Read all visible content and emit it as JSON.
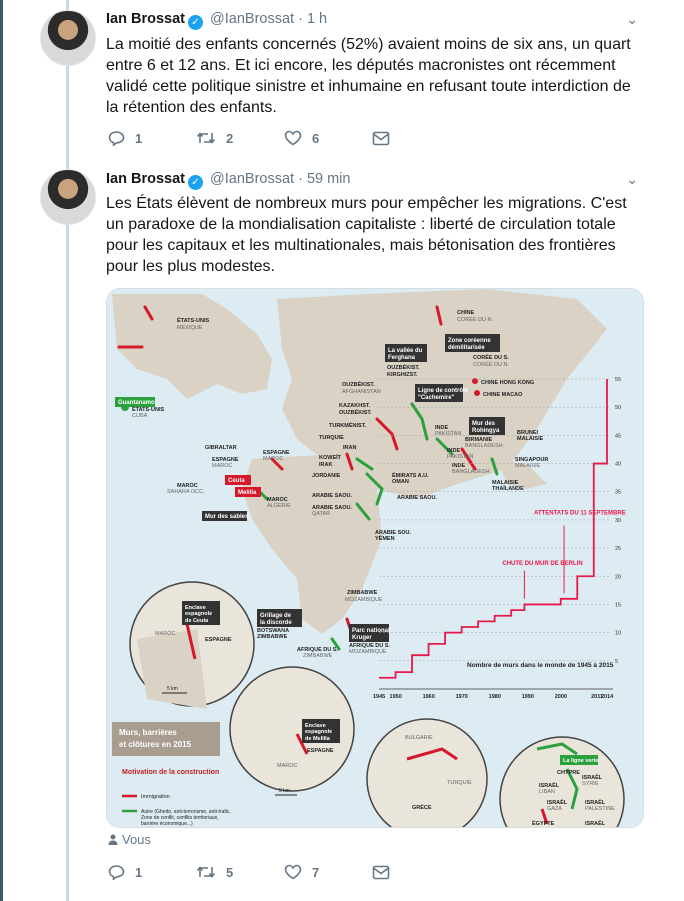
{
  "tweets": [
    {
      "name": "Ian Brossat",
      "handle": "@IanBrossat",
      "time": "· 1 h",
      "text": "La moitié des enfants concernés (52%) avaient moins de six ans, un quart entre 6 et 12 ans. Et ici encore, les députés macronistes ont récemment validé cette politique sinistre et inhumaine en refusant toute interdiction de la rétention des enfants.",
      "replies": "1",
      "retweets": "2",
      "likes": "6"
    },
    {
      "name": "Ian Brossat",
      "handle": "@IanBrossat",
      "time": "· 59 min",
      "text": "Les États élèvent de nombreux murs pour empêcher les migrations. C'est un paradoxe de la mondialisation capitaliste : liberté de circulation totale pour les capitaux et les multinationales, mais bétonisation des frontières pour les plus modestes.",
      "replies": "1",
      "retweets": "5",
      "likes": "7"
    }
  ],
  "media_reply_label": "Vous",
  "map": {
    "region_labels": [
      "ÉTATS-UNIS",
      "MEXIQUE",
      "CUBA",
      "CHINE",
      "CORÉE DU N.",
      "CORÉE DU S.",
      "OUZBÉKIST.",
      "KIRGHIZST.",
      "AFGHANISTAN",
      "KAZAKHST.",
      "TURKMÉNIST.",
      "INDE",
      "PAKISTAN",
      "BIRMANIE",
      "BANGLADESH",
      "IRAN",
      "IRAK",
      "KOWEÏT",
      "JORDANIE",
      "ARABIE SAOU.",
      "QATAR",
      "ÉMIRATS A.U.",
      "OMAN",
      "YÉMEN",
      "ESPAGNE",
      "MAROC",
      "ALGÉRIE",
      "SAHARA OCC.",
      "GIBRALTAR",
      "BRUNEI",
      "MALAISIE",
      "SINGAPOUR",
      "THAÏLANDE",
      "ZIMBABWE",
      "BOTSWANA",
      "AFRIQUE DU S.",
      "MOZAMBIQUE",
      "TURQUIE",
      "GRÈCE",
      "BULGARIE",
      "ISRAËL",
      "LIBAN",
      "SYRIE",
      "ÉGYPTE",
      "GAZA",
      "PALESTINE",
      "CHYPRE",
      "HONG KONG",
      "MACAO",
      "CHINE",
      "ÉTATS-UNIS"
    ],
    "boxes": [
      "Guantanamo",
      "Zone coréenne démilitarisée",
      "La vallée du Ferghana",
      "Ligne de contrôle \"Cachemire\"",
      "Mur des Rohingya",
      "Mur des sables",
      "Ceuta",
      "Melilla",
      "Grillage de la discorde",
      "Parc national Kruger",
      "Enclave espagnole de Ceuta",
      "Enclave espagnole de Melilla",
      "La ligne verte",
      "Murs, barrières et clôtures en 2015"
    ],
    "legend_title": "Motivation de la construction",
    "legend_items": [
      "Immigration",
      "Autre (Ghetto, anti-terrorisme, anti-trafic, Zone de conflit, conflits territoriaux, barrière économique...)"
    ],
    "colors": {
      "immigration": "#d7182a",
      "other": "#2ca03c",
      "land": "#d9d2c5",
      "sea": "#ddecf3"
    },
    "inset_scale": "5 km"
  },
  "chart_data": {
    "type": "line",
    "title": "Nombre de murs dans le monde de 1945 à 2015",
    "x_ticks": [
      "1945",
      "1950",
      "1960",
      "1970",
      "1980",
      "1990",
      "2000",
      "2011",
      "2014"
    ],
    "y_ticks": [
      "5",
      "10",
      "15",
      "20",
      "25",
      "30",
      "35",
      "40",
      "45",
      "50",
      "55"
    ],
    "ylim": [
      0,
      55
    ],
    "x": [
      1945,
      1950,
      1955,
      1960,
      1965,
      1970,
      1975,
      1980,
      1985,
      1989,
      1990,
      1995,
      2000,
      2001,
      2005,
      2010,
      2014
    ],
    "values": [
      2,
      3,
      6,
      8,
      10,
      11,
      12,
      13,
      14,
      15,
      15,
      15,
      16,
      16,
      20,
      40,
      55
    ],
    "annotations": [
      "CHUTE DU MUR DE BERLIN",
      "ATTENTATS DU 11 SEPTEMBRE"
    ],
    "line_color": "#e8184a"
  }
}
